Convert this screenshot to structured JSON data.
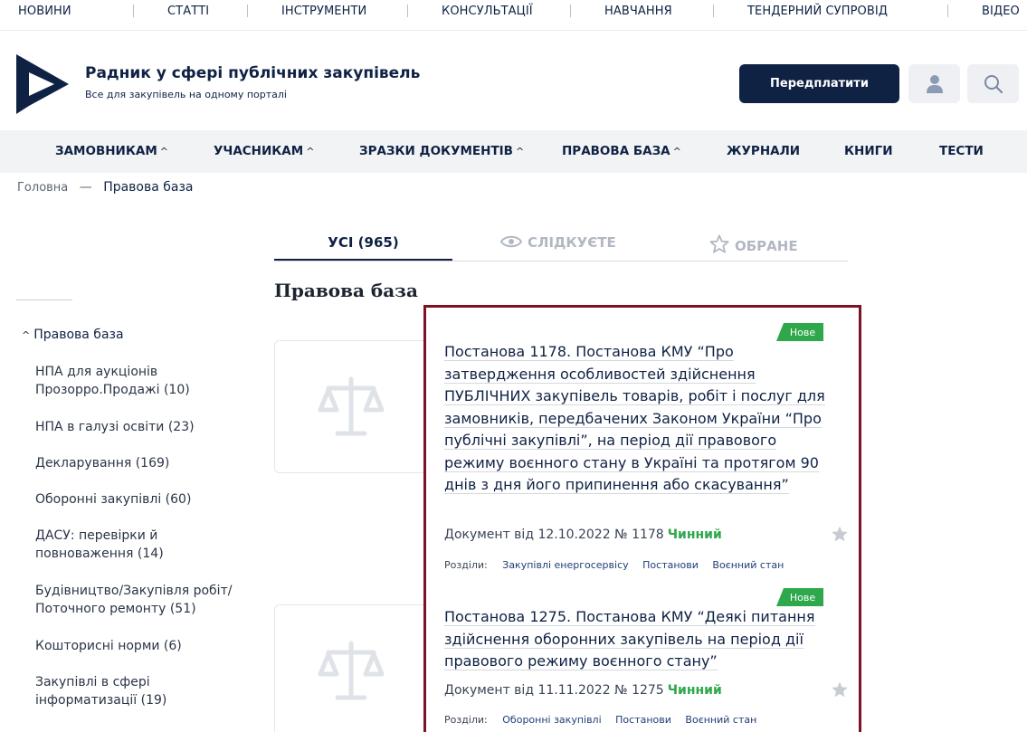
{
  "topnav": [
    "НОВИНИ",
    "СТАТТІ",
    "ІНСТРУМЕНТИ",
    "КОНСУЛЬТАЦІЇ",
    "НАВЧАННЯ",
    "ТЕНДЕРНИЙ СУПРОВІД",
    "ВІДЕО"
  ],
  "brand": {
    "title": "Радник у сфері публічних закупівель",
    "subtitle": "Все для закупівель на одному порталі"
  },
  "header": {
    "subscribe_label": "Передплатити"
  },
  "mainmenu": [
    "ЗАМОВНИКАМ",
    "УЧАСНИКАМ",
    "ЗРАЗКИ ДОКУМЕНТІВ",
    "ПРАВОВА БАЗА",
    "ЖУРНАЛИ",
    "КНИГИ",
    "ТЕСТИ"
  ],
  "breadcrumb": {
    "home": "Головна",
    "separator": "—",
    "current": "Правова база"
  },
  "tabs": {
    "all": "УСІ (965)",
    "watching": "СЛІДКУЄТЕ",
    "favorites": "ОБРАНЕ"
  },
  "page_title": "Правова база",
  "sidebar": {
    "root": "Правова база",
    "items": [
      "НПА для аукціонів Прозорро.Продажі (10)",
      "НПА в галузі освіти (23)",
      "Декларування (169)",
      "Оборонні закупівлі (60)",
      "ДАСУ: перевірки й повноваження (14)",
      "Будівництво/Закупівля робіт/ Поточного ремонту (51)",
      "Кошторисні норми (6)",
      "Закупівлі в сфері інформатизації (19)"
    ]
  },
  "documents": [
    {
      "badge": "Нове",
      "title": "Постанова 1178. Постанова КМУ “Про затвердження особливостей здійснення ПУБЛІЧНИХ закупівель товарів, робіт і послуг для замовників, передбачених Законом України “Про публічні закупівлі”, на період дії правового режиму воєнного стану в Україні та протягом 90 днів з дня його припинення або скасування”",
      "meta": "Документ від 12.10.2022 № 1178",
      "status": "Чинний",
      "sections_label": "Розділи:",
      "tags": [
        "Закупівлі енергосервісу",
        "Постанови",
        "Воєнний стан"
      ]
    },
    {
      "badge": "Нове",
      "title": "Постанова 1275. Постанова КМУ “Деякі питання здійснення оборонних закупівель на період дії правового режиму воєнного стану”",
      "meta": "Документ від 11.11.2022 № 1275",
      "status": "Чинний",
      "sections_label": "Розділи:",
      "tags": [
        "Оборонні закупівлі",
        "Постанови",
        "Воєнний стан"
      ]
    }
  ],
  "colors": {
    "brand_navy": "#0f2244",
    "status_green": "#2ea84a",
    "highlight_border": "#7b1225"
  }
}
